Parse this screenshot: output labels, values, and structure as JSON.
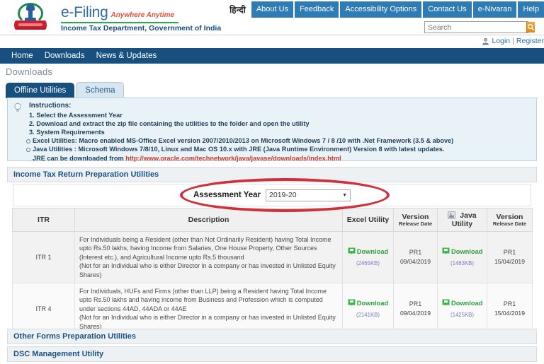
{
  "header": {
    "brand_name": "e-Filing",
    "brand_tagline": "Anywhere Anytime",
    "department": "Income Tax Department, Government of India",
    "hindi_label": "हिन्दी",
    "nav_links": [
      "About Us",
      "Feedback",
      "Accessibility Options",
      "Contact Us",
      "e-Nivaran",
      "Help"
    ],
    "search_placeholder": "Search",
    "search_value": "",
    "login_label": "Login",
    "login_separator": "|",
    "register_label": "Register"
  },
  "mainnav": {
    "items": [
      "Home",
      "Downloads",
      "News & Updates"
    ]
  },
  "page": {
    "title": "Downloads"
  },
  "tabs": [
    {
      "label": "Offline Utilities",
      "active": true
    },
    {
      "label": "Schema",
      "active": false
    }
  ],
  "instructions": {
    "heading": "Instructions:",
    "steps": [
      "1. Select the Assessment Year",
      "2. Download and extract the zip file containing the utilities to the folder and open the utility",
      "3. System Requirements"
    ],
    "requirements": [
      "Excel Utilities:  Macro enabled MS-Office Excel version 2007/2010/2013 on Microsoft Windows 7 / 8 /10 with .Net Framework (3.5 & above)",
      "Java Utilities :  Microsoft Windows 7/8/10, Linux and Mac OS 10.x with JRE (Java Runtime Environment) Version 8 with latest updates."
    ],
    "jre_prefix": "JRE can be downloaded from ",
    "jre_link": "http://www.oracle.com/technetwork/java/javase/downloads/index.html"
  },
  "sections": {
    "itr_utilities": "Income Tax Return Preparation Utilities",
    "other_forms": "Other Forms Preparation Utilities",
    "dsc_management": "DSC Management Utility"
  },
  "assessment_year": {
    "label": "Assessment Year",
    "selected": "2019-20",
    "caret": "▼"
  },
  "table": {
    "headers": {
      "itr": "ITR",
      "description": "Description",
      "excel_utility": "Excel Utility",
      "version_excel": "Version",
      "version_excel_sub": "Release Date",
      "java_utility": "Java Utility",
      "version_java": "Version",
      "version_java_sub": "Release Date"
    },
    "download_label": "Download",
    "rows": [
      {
        "itr": "ITR 1",
        "description_lines": [
          "For Individuals being a Resident (other than Not Ordinarily Resident) having Total",
          "Income upto Rs.50 lakhs, having Income from Salaries, One House Property, Other",
          "Sources (Interest etc.), and Agricultural Income upto Rs.5 thousand",
          "(Not for an Individual who is either Director in a company or has invested in",
          "Unlisted Equity Shares)"
        ],
        "excel_size": "(2465KB)",
        "excel_version": "PR1",
        "excel_date": "09/04/2019",
        "java_size": "(1483KB)",
        "java_version": "PR1",
        "java_date": "15/04/2019"
      },
      {
        "itr": "ITR 4",
        "description_lines": [
          "For Individuals, HUFs and Firms (other than LLP) being a Resident having Total",
          "Income upto Rs.50 lakhs and having income from Business and Profession which",
          "is computed under sections 44AD, 44ADA or 44AE",
          "(Not for an Individual who is either Director in a company or has invested in",
          "Unlisted Equity Shares)"
        ],
        "excel_size": "(2141KB)",
        "excel_version": "PR1",
        "excel_date": "09/04/2019",
        "java_size": "(1425KB)",
        "java_version": "PR1",
        "java_date": "15/04/2019"
      }
    ]
  },
  "colors": {
    "nav_blue": "#17507f",
    "link_blue": "#2f6ca8",
    "tab_button_blue": "#2f7cb5",
    "download_green": "#2e9e3e",
    "annotation_red": "#cc1f2a",
    "search_orange": "#e08a16",
    "instruction_bg": "#e9f2f7"
  }
}
